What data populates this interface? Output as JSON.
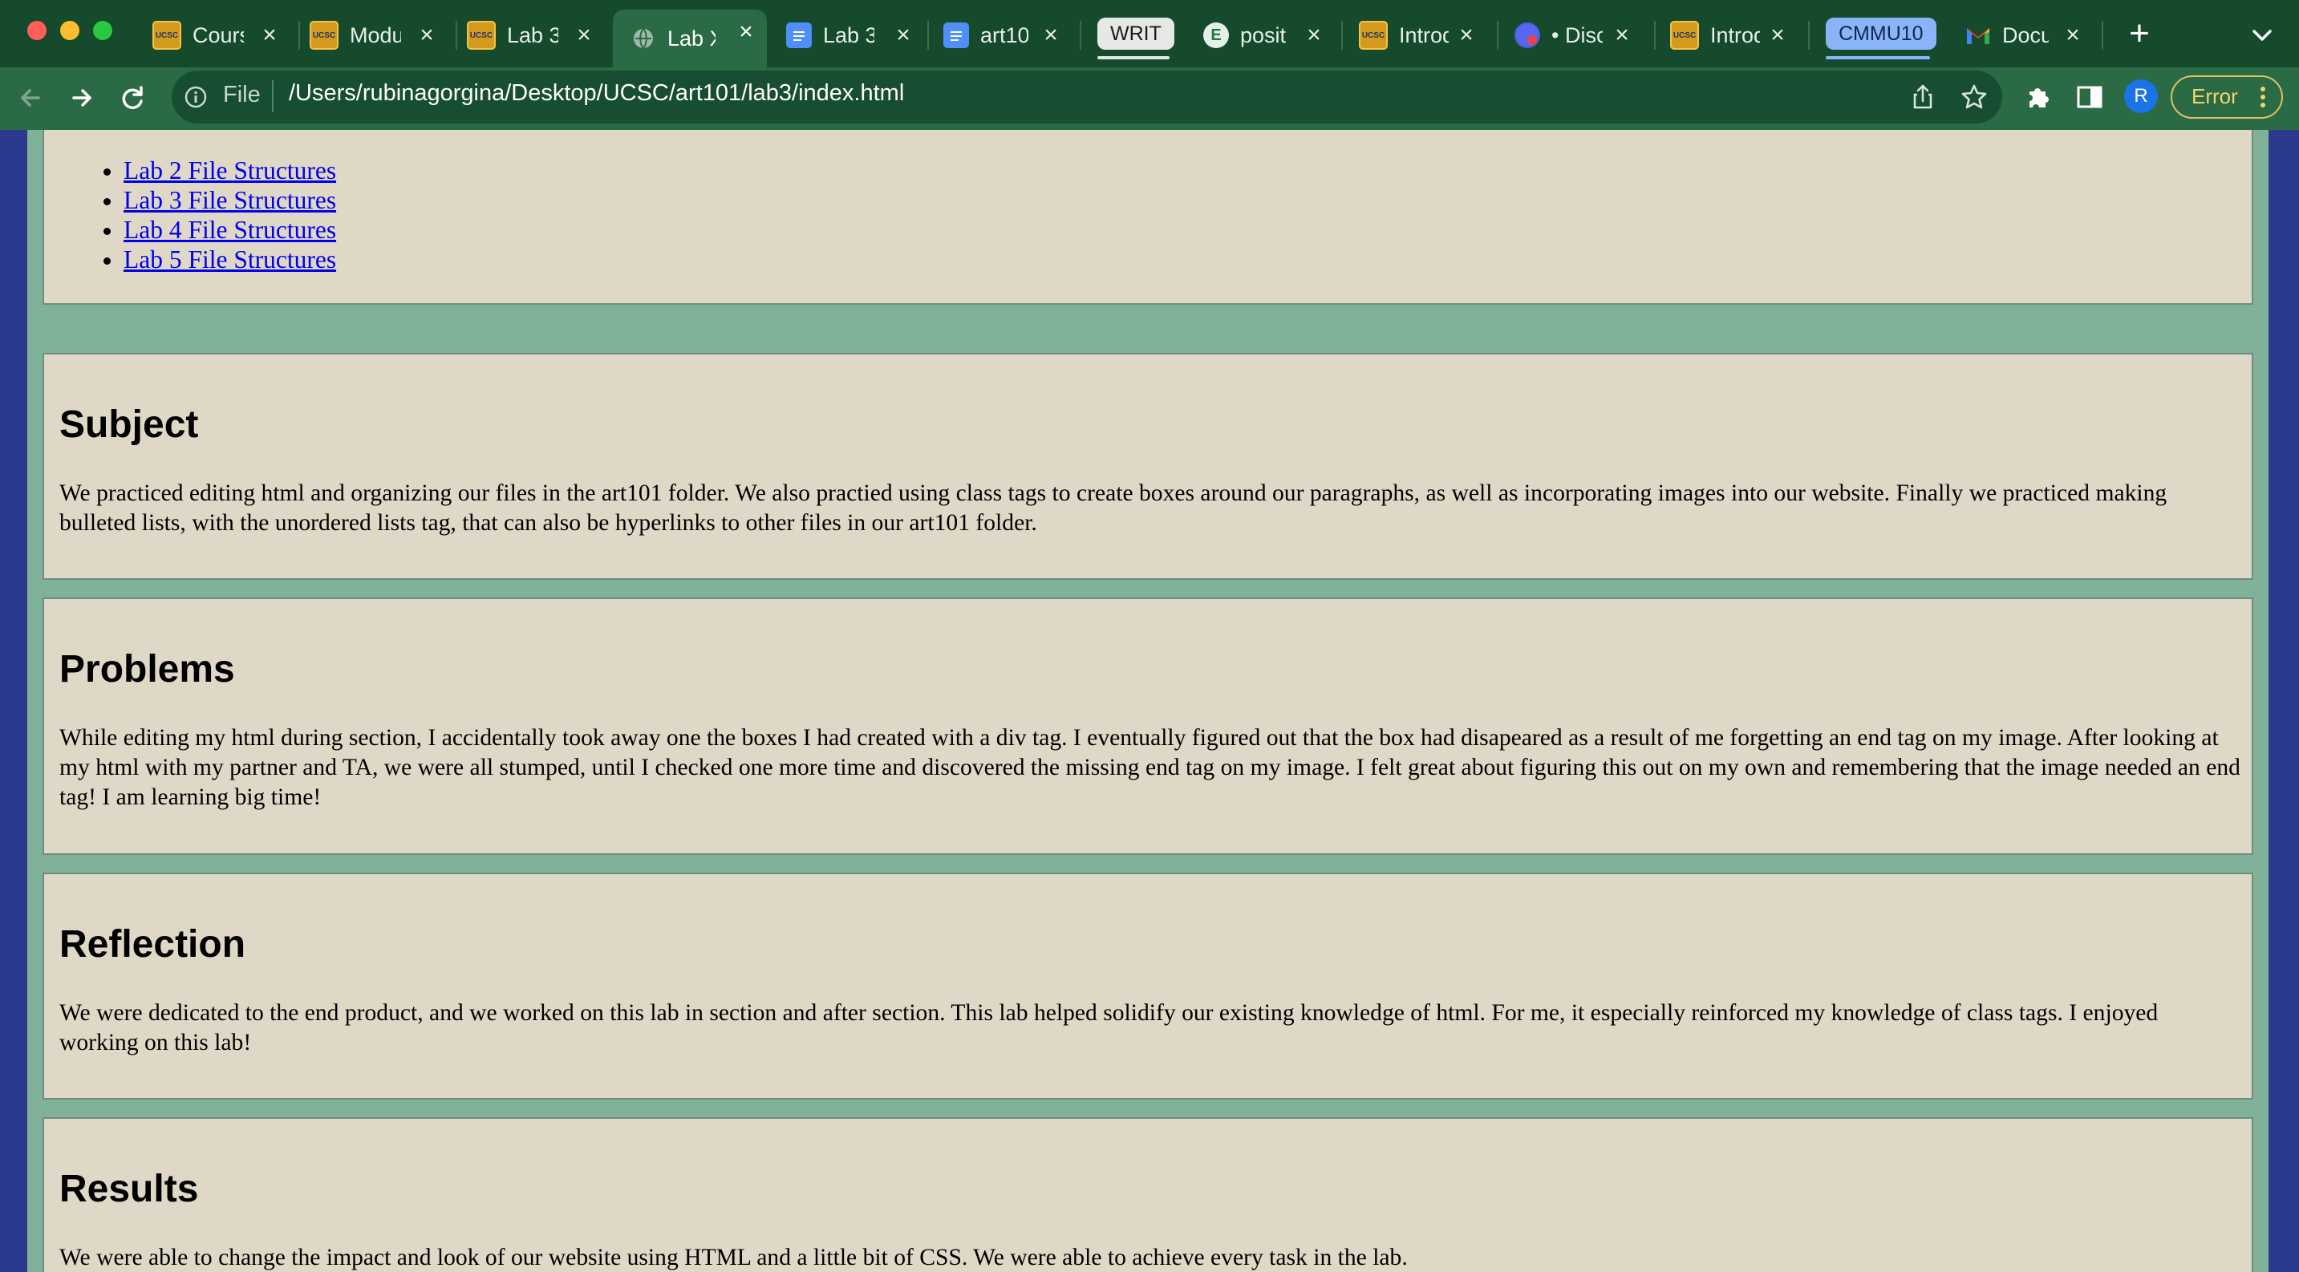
{
  "browser": {
    "tabs": [
      {
        "title": "Cours",
        "favicon": "ucsc-icon",
        "active": false
      },
      {
        "title": "Modu",
        "favicon": "ucsc-icon",
        "active": false
      },
      {
        "title": "Lab 3",
        "favicon": "ucsc-icon",
        "active": false
      },
      {
        "title": "Lab X",
        "favicon": "globe-icon",
        "active": true
      },
      {
        "title": "Lab 3",
        "favicon": "docs-icon",
        "active": false
      },
      {
        "title": "art10",
        "favicon": "docs-icon",
        "active": false
      },
      {
        "title": "WRIT",
        "favicon": "",
        "active": false,
        "group_chip": true
      },
      {
        "title": "posit",
        "favicon": "evernote-icon",
        "active": false
      },
      {
        "title": "Introd",
        "favicon": "ucsc-icon",
        "active": false
      },
      {
        "title": "• Disc",
        "favicon": "discord-icon",
        "active": false
      },
      {
        "title": "Introd",
        "favicon": "ucsc-icon",
        "active": false
      },
      {
        "title": "CMMU10",
        "favicon": "",
        "active": false,
        "group_chip": true
      },
      {
        "title": "Docu",
        "favicon": "gmail-icon",
        "active": false
      }
    ],
    "favicon_text": {
      "ucsc": "UCSC"
    },
    "url_scheme_label": "File",
    "url": "/Users/rubinagorgina/Desktop/UCSC/art101/lab3/index.html",
    "profile_initial": "R",
    "error_label": "Error",
    "colors": {
      "tabstrip": "#164a2d",
      "toolbar": "#2a6a44",
      "writ_chip": "#e6e8e6",
      "cmmu_chip": "#8ab4f8"
    }
  },
  "page": {
    "links": [
      "Lab 2 File Structures",
      "Lab 3 File Structures",
      "Lab 4 File Structures",
      "Lab 5 File Structures"
    ],
    "sections": [
      {
        "heading": "Subject",
        "body": "We practiced editing html and organizing our files in the art101 folder. We also practied using class tags to create boxes around our paragraphs, as well as incorporating images into our website. Finally we practiced making bulleted lists, with the unordered lists tag, that can also be hyperlinks to other files in our art101 folder."
      },
      {
        "heading": "Problems",
        "body": "While editing my html during section, I accidentally took away one the boxes I had created with a div tag. I eventually figured out that the box had disapeared as a result of me forgetting an end tag on my image. After looking at my html with my partner and TA, we were all stumped, until I checked one more time and discovered the missing end tag on my image. I felt great about figuring this out on my own and remembering that the image needed an end tag! I am learning big time!"
      },
      {
        "heading": "Reflection",
        "body": "We were dedicated to the end product, and we worked on this lab in section and after section. This lab helped solidify our existing knowledge of html. For me, it especially reinforced my knowledge of class tags. I enjoyed working on this lab!"
      },
      {
        "heading": "Results",
        "body": "We were able to change the impact and look of our website using HTML and a little bit of CSS. We were able to achieve every task in the lab."
      }
    ],
    "colors": {
      "page_bg": "#2b3a8c",
      "content_bg": "#80b29a",
      "box_bg": "#dfd8c6",
      "link": "#0000ee"
    }
  }
}
